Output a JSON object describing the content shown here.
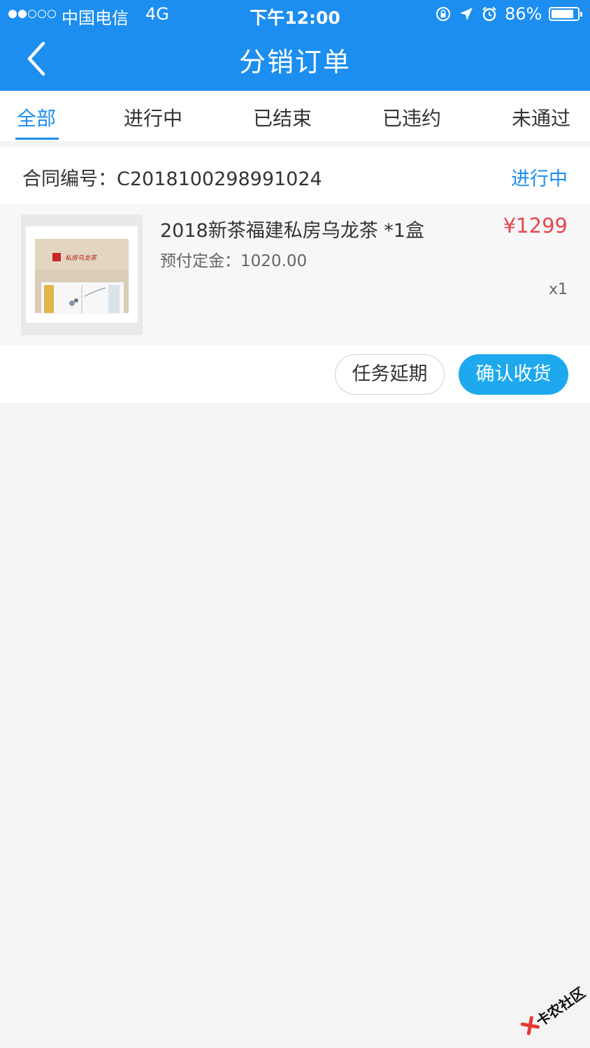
{
  "status_bar": {
    "carrier": "中国电信",
    "network": "4G",
    "time": "下午12:00",
    "battery": "86%",
    "battery_level": 0.86,
    "signal_bars": 2,
    "icons": [
      "rotation-lock-icon",
      "location-arrow-icon",
      "alarm-icon",
      "battery-icon"
    ]
  },
  "nav": {
    "title": "分销订单",
    "back_icon": "chevron-left-icon"
  },
  "tabs": [
    {
      "label": "全部",
      "active": true
    },
    {
      "label": "进行中",
      "active": false
    },
    {
      "label": "已结束",
      "active": false
    },
    {
      "label": "已违约",
      "active": false
    },
    {
      "label": "未通过",
      "active": false
    }
  ],
  "order": {
    "contract_label": "合同编号：",
    "contract_no": "C2018100298991024",
    "status": "进行中",
    "item": {
      "name": "2018新茶福建私房乌龙茶 *1盒",
      "price": "¥1299",
      "deposit_label": "预付定金：",
      "deposit_value": "1020.00",
      "quantity": "x1",
      "box_print": "私房乌龙茶"
    },
    "actions": {
      "delay": "任务延期",
      "confirm": "确认收货"
    }
  },
  "watermark": "卡农社区",
  "colors": {
    "primary": "#1c8ef0",
    "button_blue": "#1ea9ee",
    "price_red": "#e5484d",
    "background": "#f4f4f4"
  }
}
